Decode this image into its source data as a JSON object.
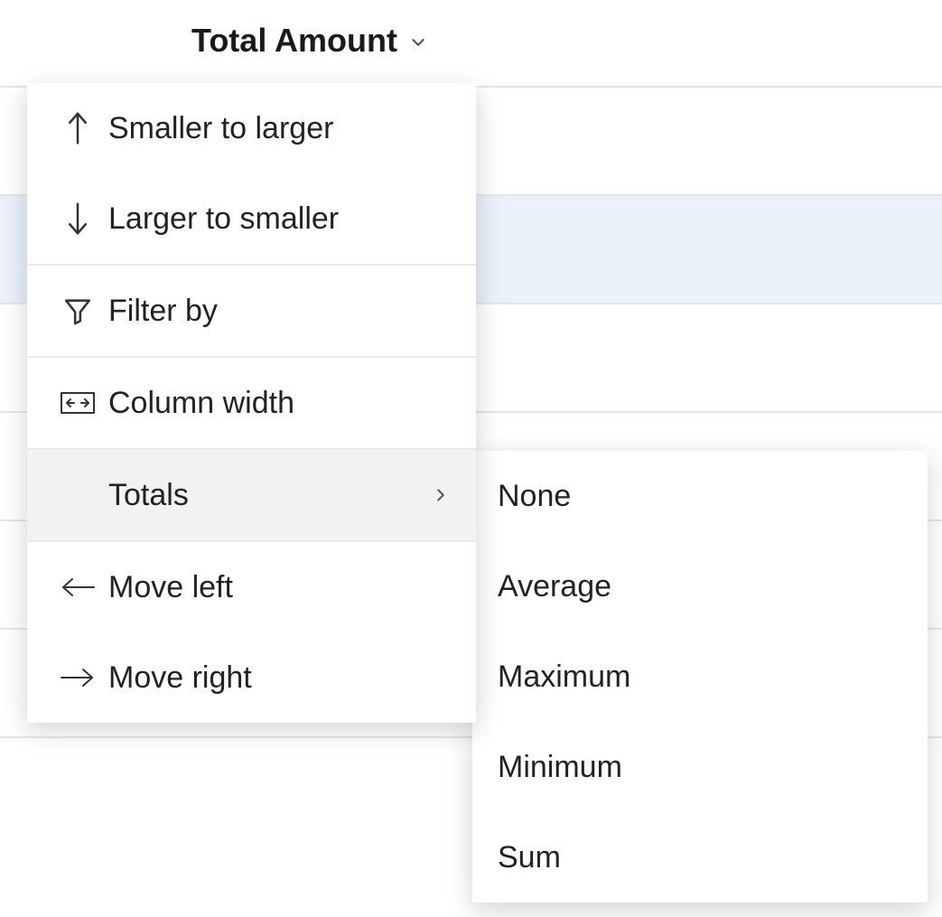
{
  "header": {
    "column_title": "Total Amount"
  },
  "menu": {
    "items": [
      {
        "label": "Smaller to larger"
      },
      {
        "label": "Larger to smaller"
      },
      {
        "label": "Filter by"
      },
      {
        "label": "Column width"
      },
      {
        "label": "Totals"
      },
      {
        "label": "Move left"
      },
      {
        "label": "Move right"
      }
    ]
  },
  "submenu": {
    "items": [
      {
        "label": "None"
      },
      {
        "label": "Average"
      },
      {
        "label": "Maximum"
      },
      {
        "label": "Minimum"
      },
      {
        "label": "Sum"
      }
    ]
  }
}
